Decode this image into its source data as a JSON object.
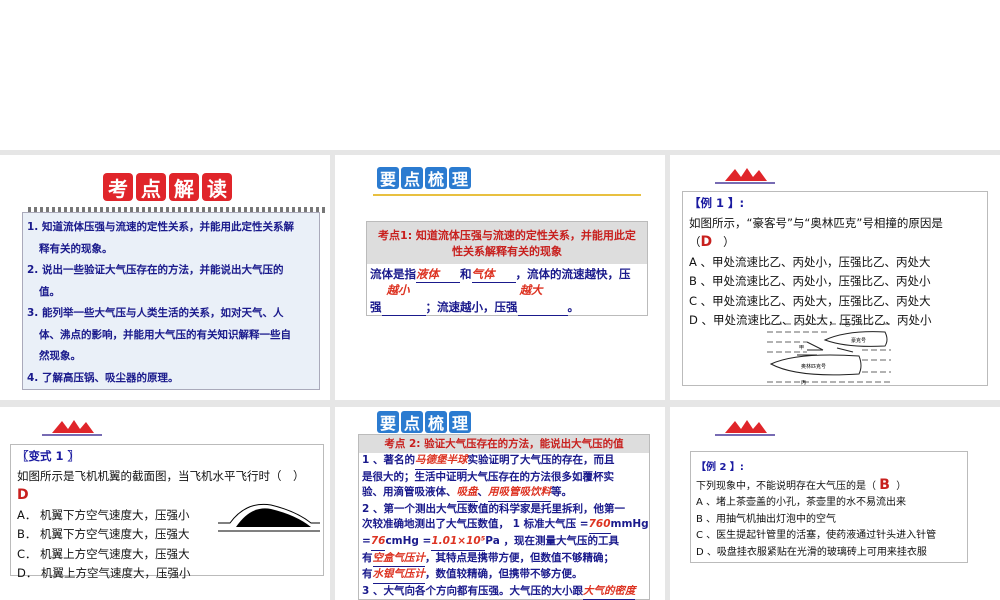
{
  "slide1": {
    "title_chars": [
      "考",
      "点",
      "解",
      "读"
    ],
    "items": [
      "1. 知道流体压强与流速的定性关系，并能用此定性关系解",
      "释有关的现象。",
      "2. 说出一些验证大气压存在的方法，并能说出大气压的",
      "值。",
      "3. 能列举一些大气压与人类生活的关系，如对天气、人",
      "体、沸点的影响，并能用大气压的有关知识解释一些自",
      "然现象。",
      "4. 了解高压锅、吸尘器的原理。"
    ]
  },
  "slide2": {
    "title_chars": [
      "要",
      "点",
      "梳",
      "理"
    ],
    "header": "考点1: 知道流体压强与流速的定性关系，并能用此定性关系解释有关的现象",
    "t1": "流体是指",
    "a1": "液体",
    "t2": "和",
    "a2": "气体",
    "t3": "，流体的流速越快，压",
    "t4": "强",
    "a3": "越小",
    "t5": "；流速越小，压强",
    "a4": "越大",
    "t6": "。"
  },
  "slide3": {
    "label": "【例 1 】:",
    "question": "如图所示，“豪客号”与“奥林匹克”号相撞的原因是（",
    "answer": "D",
    "close": "）",
    "options": [
      "A 、甲处流速比乙、丙处小，压强比乙、丙处大",
      "B 、甲处流速比乙、丙处小，压强比乙、丙处小",
      "C 、甲处流速比乙、丙处大，压强比乙、丙处大",
      "D 、甲处流速比乙、丙处大，压强比乙、丙处小"
    ],
    "fig": {
      "ship1": "豪克号",
      "ship2": "奥林匹克号",
      "jia": "甲",
      "yi": "乙",
      "bing": "丙"
    }
  },
  "slide4": {
    "label": "〖变式 1 〗",
    "question": "如图所示是飞机机翼的截面图，当飞机水平飞行时（　）",
    "answer": "D",
    "options": [
      "A． 机翼下方空气速度大，压强小",
      "B． 机翼下方空气速度大，压强大",
      "C． 机翼上方空气速度大，压强大",
      "D． 机翼上方空气速度大，压强小"
    ]
  },
  "slide5": {
    "title_chars": [
      "要",
      "点",
      "梳",
      "理"
    ],
    "header": "考点 2: 验证大气压存在的方法，能说出大气压的值",
    "l1a": "1 、著名的",
    "l1ans": "马德堡半球",
    "l1b": "实验证明了大气压的存在，而且",
    "l2": "是很大的；生活中证明大气压存在的方法很多如覆杯实",
    "l3a": "验、用滴管吸液体、",
    "l3ans1": "吸盘",
    "l3b": "、",
    "l3ans2": "用吸管吸饮料",
    "l3c": "等。",
    "l4": "2 、第一个测出大气压数值的科学家是托里拆利，他第一",
    "l5a": "次较准确地测出了大气压数值， 1 标准大气压 =",
    "l5ans": "760",
    "l5b": "mmHg",
    "l6a": "=",
    "l6ans1": "76",
    "l6b": "cmHg =",
    "l6ans2": "1.01×10⁵",
    "l6c": "Pa ，现在测量大气压的工具",
    "l7a": "有",
    "l7ans": "空盒气压计",
    "l7b": "，其特点是携带方便，但数值不够精确；",
    "l8a": "有",
    "l8ans": "水银气压计",
    "l8b": "，数值较精确，但携带不够方便。",
    "l9a": "3 、大气向各个方向都有压强。大气压的大小跟",
    "l9ans": "大气的密度"
  },
  "slide6": {
    "label": "【例 2 】:",
    "question": "下列现象中，不能说明存在大气压的是（",
    "answer": "B",
    "close": "）",
    "options": [
      "A 、堵上茶壶盖的小孔，茶壶里的水不易流出来",
      "B 、用抽气机抽出灯泡中的空气",
      "C 、医生提起针管里的活塞，使药液通过针头进入针管",
      "D 、吸盘挂衣服紧贴在光滑的玻璃砖上可用来挂衣服"
    ]
  }
}
